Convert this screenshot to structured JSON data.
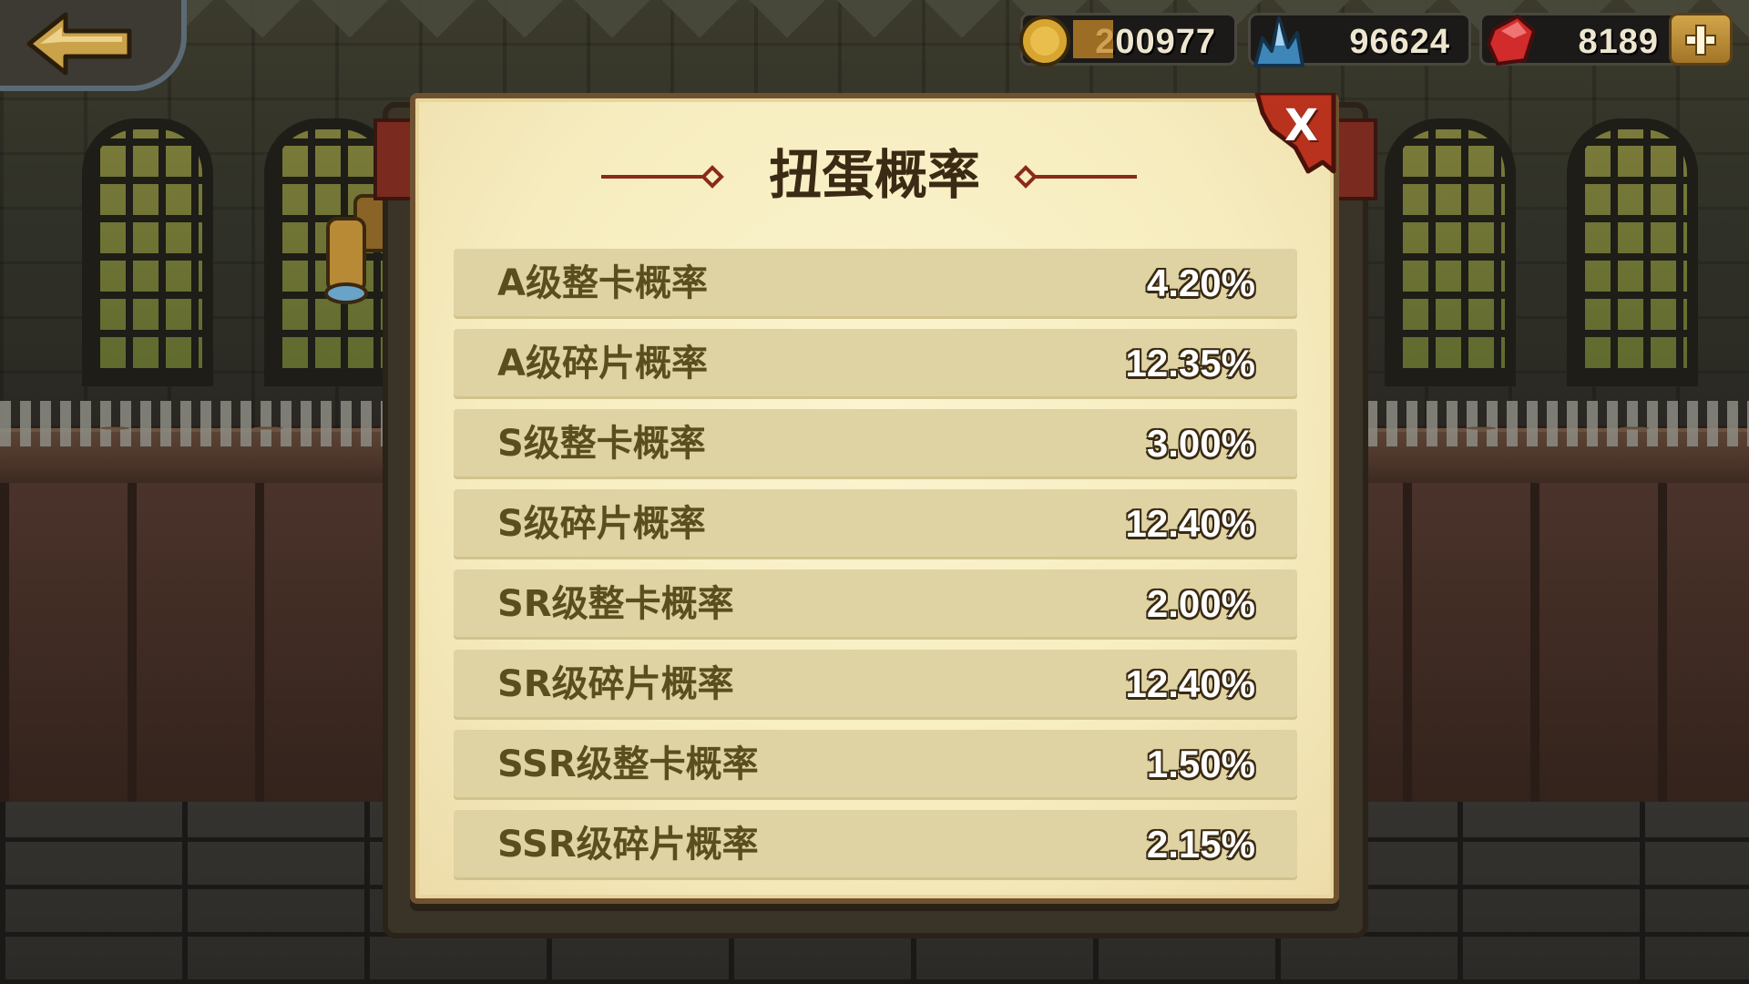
{
  "topbar": {
    "back_icon": "back-arrow-icon",
    "currencies": [
      {
        "name": "gold-coin",
        "icon": "gold-coin-icon",
        "amount": "200977"
      },
      {
        "name": "crystal",
        "icon": "blue-crystal-icon",
        "amount": "96624"
      },
      {
        "name": "ruby",
        "icon": "red-gem-icon",
        "amount": "8189"
      }
    ],
    "plus_icon": "plus-icon"
  },
  "dialog": {
    "title": "扭蛋概率",
    "close_label": "X",
    "rates": [
      {
        "label": "A级整卡概率",
        "value": "4.20%"
      },
      {
        "label": "A级碎片概率",
        "value": "12.35%"
      },
      {
        "label": "S级整卡概率",
        "value": "3.00%"
      },
      {
        "label": "S级碎片概率",
        "value": "12.40%"
      },
      {
        "label": "SR级整卡概率",
        "value": "2.00%"
      },
      {
        "label": "SR级碎片概率",
        "value": "12.40%"
      },
      {
        "label": "SSR级整卡概率",
        "value": "1.50%"
      },
      {
        "label": "SSR级碎片概率",
        "value": "2.15%"
      }
    ]
  },
  "colors": {
    "dialog_bg": "#f6ecbe",
    "row_bg": "#dfd3a4",
    "label_text": "#5a4e1e",
    "title_text": "#3b2a14",
    "close_red": "#b8321e",
    "gold": "#d2a54a"
  }
}
